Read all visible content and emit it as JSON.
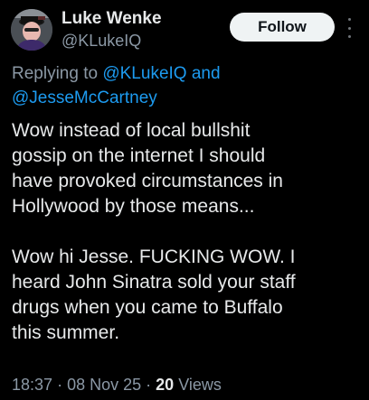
{
  "author": {
    "display_name": "Luke Wenke",
    "handle": "@KLukeIQ",
    "avatar_icon": "avatar-photo"
  },
  "follow_label": "Follow",
  "more_icon": "more-vertical-icon",
  "reply": {
    "prefix": "Replying to",
    "mention_1": "@KLukeIQ",
    "joiner": "and",
    "mention_2": "@JesseMcCartney"
  },
  "tweet": {
    "text": "Wow instead of local bullshit\ngossip on the internet I should\nhave provoked circumstances in\nHollywood by those means...\n\nWow hi Jesse.  FUCKING WOW.  I\nheard John Sinatra sold your staff\ndrugs when you came to Buffalo\nthis summer."
  },
  "meta": {
    "time": "18:37",
    "separator": "·",
    "date": "08 Nov 25",
    "views_count": "20",
    "views_label": "Views"
  },
  "colors": {
    "background": "#000000",
    "text": "#e7e9ea",
    "secondary": "#8b98a5",
    "link": "#1d9bf0",
    "button_bg": "#eff3f4"
  }
}
